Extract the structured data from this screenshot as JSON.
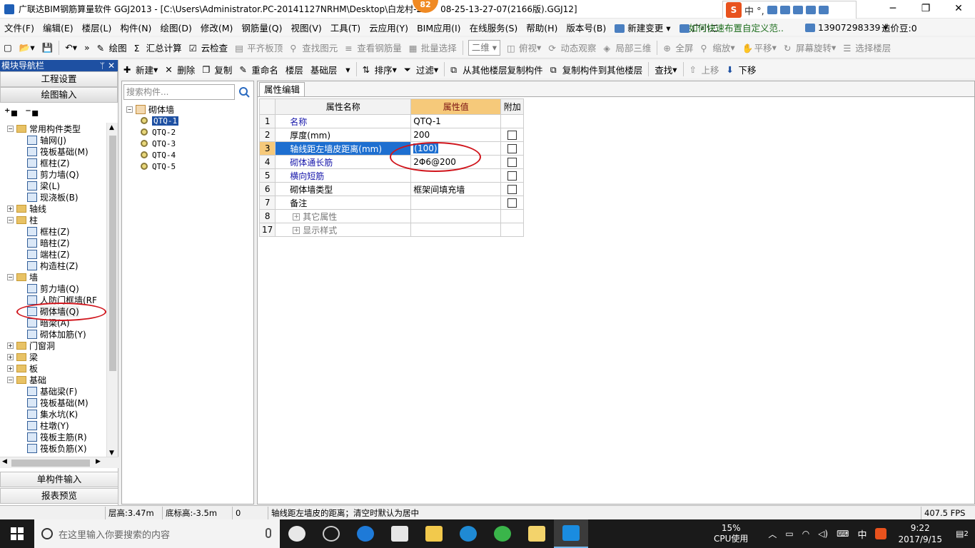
{
  "window": {
    "title": "广联达BIM钢筋算量软件 GGJ2013 - [C:\\Users\\Administrator.PC-20141127NRHM\\Desktop\\白龙村-2",
    "title_tail": "08-25-13-27-07(2166版).GGJ12]",
    "badge": "82",
    "ime_text": "中 °,"
  },
  "menu": {
    "items": [
      "文件(F)",
      "编辑(E)",
      "楼层(L)",
      "构件(N)",
      "绘图(D)",
      "修改(M)",
      "钢筋量(Q)",
      "视图(V)",
      "工具(T)",
      "云应用(Y)",
      "BIM应用(I)",
      "在线服务(S)",
      "帮助(H)",
      "版本号(B)"
    ],
    "new_change": "新建变更",
    "assistant": "广小二",
    "hint": "如何快速布置自定义范..",
    "user": "13907298339",
    "bean": "造价豆:0"
  },
  "toolbar": {
    "draw": "绘图",
    "sum": "汇总计算",
    "cloud_check": "云检查",
    "flush_board": "平齐板顶",
    "find_element": "查找图元",
    "view_rebar": "查看钢筋量",
    "batch_select": "批量选择",
    "view_mode": "二维",
    "top_view": "俯视",
    "dynamic_view": "动态观察",
    "local_3d": "局部三维",
    "fullscreen": "全屏",
    "zoom": "缩放",
    "pan": "平移",
    "rotate": "屏幕旋转",
    "select_floor": "选择楼层"
  },
  "nav": {
    "header": "模块导航栏",
    "project_settings": "工程设置",
    "drawing_input": "绘图输入",
    "single_input": "单构件输入",
    "report_preview": "报表预览",
    "tree": [
      {
        "level": 0,
        "exp": "−",
        "folder": true,
        "label": "常用构件类型"
      },
      {
        "level": 1,
        "label": "轴网(J)"
      },
      {
        "level": 1,
        "label": "筏板基础(M)"
      },
      {
        "level": 1,
        "label": "框柱(Z)"
      },
      {
        "level": 1,
        "label": "剪力墙(Q)"
      },
      {
        "level": 1,
        "label": "梁(L)"
      },
      {
        "level": 1,
        "label": "现浇板(B)"
      },
      {
        "level": 0,
        "exp": "+",
        "folder": true,
        "label": "轴线"
      },
      {
        "level": 0,
        "exp": "−",
        "folder": true,
        "label": "柱"
      },
      {
        "level": 1,
        "label": "框柱(Z)"
      },
      {
        "level": 1,
        "label": "暗柱(Z)"
      },
      {
        "level": 1,
        "label": "端柱(Z)"
      },
      {
        "level": 1,
        "label": "构造柱(Z)"
      },
      {
        "level": 0,
        "exp": "−",
        "folder": true,
        "label": "墙"
      },
      {
        "level": 1,
        "label": "剪力墙(Q)"
      },
      {
        "level": 1,
        "label": "人防门框墙(RF"
      },
      {
        "level": 1,
        "label": "砌体墙(Q)",
        "selected": true
      },
      {
        "level": 1,
        "label": "暗梁(A)"
      },
      {
        "level": 1,
        "label": "砌体加筋(Y)"
      },
      {
        "level": 0,
        "exp": "+",
        "folder": true,
        "label": "门窗洞"
      },
      {
        "level": 0,
        "exp": "+",
        "folder": true,
        "label": "梁"
      },
      {
        "level": 0,
        "exp": "+",
        "folder": true,
        "label": "板"
      },
      {
        "level": 0,
        "exp": "−",
        "folder": true,
        "label": "基础"
      },
      {
        "level": 1,
        "label": "基础梁(F)"
      },
      {
        "level": 1,
        "label": "筏板基础(M)"
      },
      {
        "level": 1,
        "label": "集水坑(K)"
      },
      {
        "level": 1,
        "label": "柱墩(Y)"
      },
      {
        "level": 1,
        "label": "筏板主筋(R)"
      },
      {
        "level": 1,
        "label": "筏板负筋(X)"
      }
    ]
  },
  "toolbar2": {
    "new": "新建",
    "delete": "删除",
    "copy": "复制",
    "rename": "重命名",
    "floor_label": "楼层",
    "floor_value": "基础层",
    "sort": "排序",
    "filter": "过滤",
    "copy_from": "从其他楼层复制构件",
    "copy_to": "复制构件到其他楼层",
    "find": "查找",
    "move_up": "上移",
    "move_down": "下移"
  },
  "components": {
    "search_placeholder": "搜索构件...",
    "root": "砌体墙",
    "items": [
      "QTQ-1",
      "QTQ-2",
      "QTQ-3",
      "QTQ-4",
      "QTQ-5"
    ],
    "selected": 0
  },
  "properties": {
    "tab": "属性编辑",
    "headers": {
      "name": "属性名称",
      "value": "属性值",
      "extra": "附加"
    },
    "rows": [
      {
        "num": "1",
        "name": "名称",
        "value": "QTQ-1",
        "color": "blue",
        "checkbox": false
      },
      {
        "num": "2",
        "name": "厚度(mm)",
        "value": "200",
        "color": "black",
        "checkbox": true
      },
      {
        "num": "3",
        "name": "轴线距左墙皮距离(mm)",
        "value": "(100)",
        "color": "blue",
        "checkbox": true,
        "selected": true
      },
      {
        "num": "4",
        "name": "砌体通长筋",
        "value": "2Φ6@200",
        "color": "blue",
        "checkbox": true
      },
      {
        "num": "5",
        "name": "横向短筋",
        "value": "",
        "color": "blue",
        "checkbox": true
      },
      {
        "num": "6",
        "name": "砌体墙类型",
        "value": "框架间填充墙",
        "color": "black",
        "checkbox": true
      },
      {
        "num": "7",
        "name": "备注",
        "value": "",
        "color": "black",
        "checkbox": true
      },
      {
        "num": "8",
        "name": "其它属性",
        "value": "",
        "color": "gray",
        "expand": true
      },
      {
        "num": "17",
        "name": "显示样式",
        "value": "",
        "color": "gray",
        "expand": true
      }
    ]
  },
  "status": {
    "floor_height": "层高:3.47m",
    "bottom_height": "底标高:-3.5m",
    "zero": "0",
    "message": "轴线距左墙皮的距离；清空时默认为居中",
    "fps": "407.5 FPS"
  },
  "taskbar": {
    "search_placeholder": "在这里输入你要搜索的内容",
    "cpu_pct": "15%",
    "cpu_label": "CPU使用",
    "ime": "中",
    "time": "9:22",
    "date": "2017/9/15",
    "notif_count": "2"
  }
}
